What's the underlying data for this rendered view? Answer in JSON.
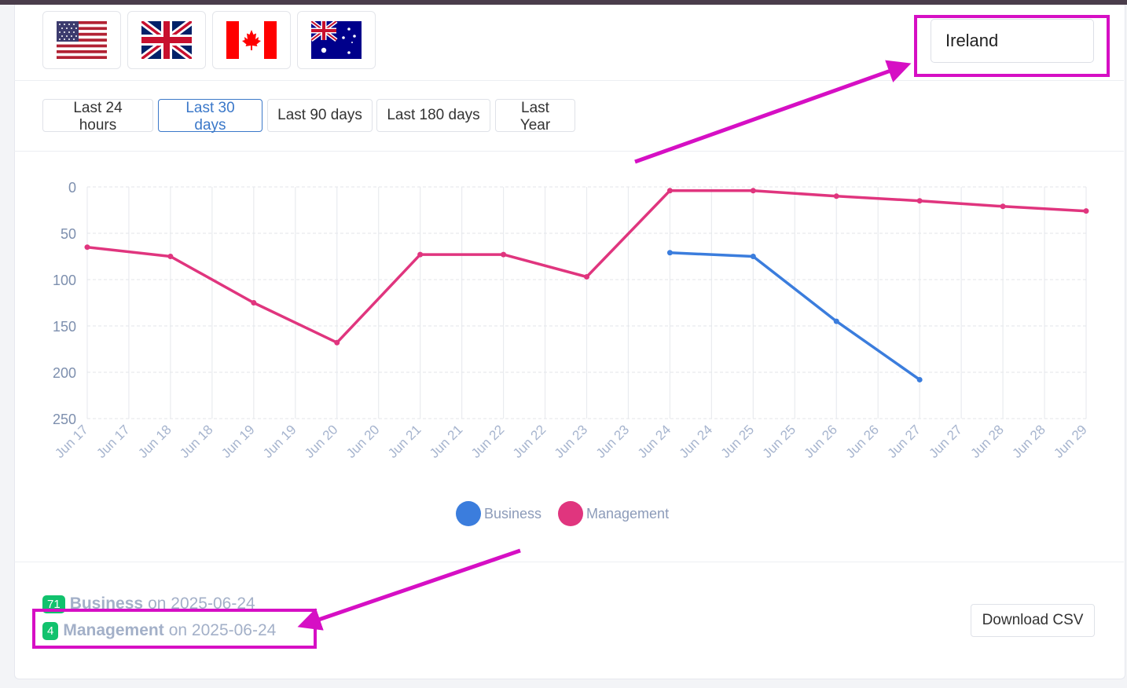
{
  "flags": [
    {
      "name": "us-flag-icon",
      "country": "United States"
    },
    {
      "name": "uk-flag-icon",
      "country": "United Kingdom"
    },
    {
      "name": "canada-flag-icon",
      "country": "Canada"
    },
    {
      "name": "australia-flag-icon",
      "country": "Australia"
    }
  ],
  "country_input": {
    "value": "Ireland"
  },
  "ranges": [
    "Last 24 hours",
    "Last 30 days",
    "Last 90 days",
    "Last 180 days",
    "Last Year"
  ],
  "active_range": "Last 30 days",
  "chart_data": {
    "type": "line",
    "x": [
      "Jun 17",
      "Jun 17",
      "Jun 18",
      "Jun 18",
      "Jun 19",
      "Jun 19",
      "Jun 20",
      "Jun 20",
      "Jun 21",
      "Jun 21",
      "Jun 22",
      "Jun 22",
      "Jun 23",
      "Jun 23",
      "Jun 24",
      "Jun 24",
      "Jun 25",
      "Jun 25",
      "Jun 26",
      "Jun 26",
      "Jun 27",
      "Jun 27",
      "Jun 28",
      "Jun 28",
      "Jun 29"
    ],
    "y_reversed": true,
    "ylim": [
      0,
      250
    ],
    "yticks": [
      0,
      50,
      100,
      150,
      200,
      250
    ],
    "grid": true,
    "series": [
      {
        "name": "Business",
        "color": "#3b7ddd",
        "points": [
          [
            14,
            71
          ],
          [
            16,
            75
          ],
          [
            18,
            145
          ],
          [
            20,
            208
          ]
        ]
      },
      {
        "name": "Management",
        "color": "#e0357e",
        "points": [
          [
            0,
            65
          ],
          [
            2,
            75
          ],
          [
            4,
            125
          ],
          [
            6,
            168
          ],
          [
            8,
            73
          ],
          [
            10,
            73
          ],
          [
            12,
            97
          ],
          [
            14,
            4
          ],
          [
            16,
            4
          ],
          [
            18,
            10
          ],
          [
            20,
            15
          ],
          [
            22,
            21
          ],
          [
            24,
            26
          ]
        ]
      }
    ]
  },
  "summary": [
    {
      "count": "71",
      "series": "Business",
      "on": "on",
      "date": "2025-06-24"
    },
    {
      "count": "4",
      "series": "Management",
      "on": "on",
      "date": "2025-06-24"
    }
  ],
  "download_label": "Download CSV",
  "colors": {
    "highlight": "#d60fc4",
    "active": "#3b78c9",
    "badge": "#11c26d"
  }
}
